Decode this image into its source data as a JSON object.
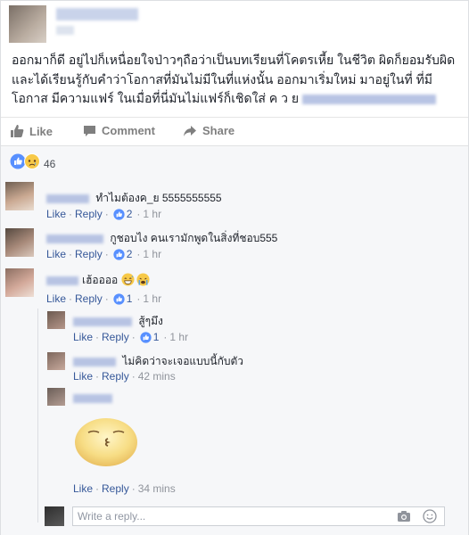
{
  "post": {
    "text_line1": "ออกมาก็ดี อยู่ไปก็เหนื่อยใจป่าวๆถือว่าเป็นบทเรียนที่โคตรเหี้ย ในชีวิต ผิดก็ยอมรับผิด",
    "text_line2": "และได้เรียนรู้กับคำว่าโอกาสที่มันไม่มีในที่แห่งนั้น ออกมาเริ่มใหม่ มาอยู่ในที่ ที่มี",
    "text_line3": "โอกาส มีความแฟร์ ในเมื่อที่นี่มันไม่แฟร์ก็เชิดใส่ ค ว ย"
  },
  "actions": {
    "like": "Like",
    "comment": "Comment",
    "share": "Share"
  },
  "reactions": {
    "count": "46"
  },
  "comments": [
    {
      "text": "ทำไมต้องค_ย 5555555555",
      "like_label": "Like",
      "reply_label": "Reply",
      "likes": "2",
      "time": "1 hr"
    },
    {
      "text": "กูชอบไง คนเรามักพูดในสิ่งที่ชอบ555",
      "like_label": "Like",
      "reply_label": "Reply",
      "likes": "2",
      "time": "1 hr"
    },
    {
      "text": "เฮ้ออออ",
      "like_label": "Like",
      "reply_label": "Reply",
      "likes": "1",
      "time": "1 hr"
    }
  ],
  "replies": [
    {
      "text": "สู้ๆมึง",
      "like_label": "Like",
      "reply_label": "Reply",
      "likes": "1",
      "time": "1 hr"
    },
    {
      "text": "ไม่คิดว่าจะเจอแบบนี้กับตัว",
      "like_label": "Like",
      "reply_label": "Reply",
      "time": "42 mins"
    },
    {
      "text": "",
      "like_label": "Like",
      "reply_label": "Reply",
      "time": "34 mins"
    }
  ],
  "reply_box": {
    "placeholder": "Write a reply..."
  },
  "colors": {
    "link": "#365899",
    "muted": "#90949c",
    "like_blue": "#5890ff",
    "background": "#f6f7f9"
  }
}
